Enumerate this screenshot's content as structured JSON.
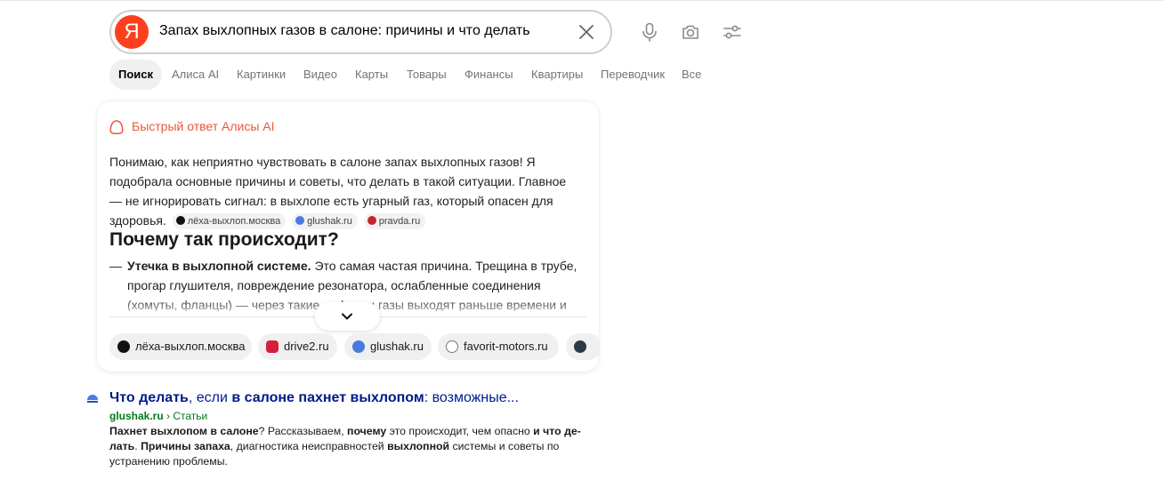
{
  "search": {
    "query": "Запах выхлопных газов в салоне: причины и что делать",
    "logo_letter": "Я"
  },
  "tabs": [
    {
      "label": "Поиск",
      "active": true
    },
    {
      "label": "Алиса AI"
    },
    {
      "label": "Картинки"
    },
    {
      "label": "Видео"
    },
    {
      "label": "Карты"
    },
    {
      "label": "Товары"
    },
    {
      "label": "Финансы"
    },
    {
      "label": "Квартиры"
    },
    {
      "label": "Переводчик"
    },
    {
      "label": "Все"
    }
  ],
  "answer": {
    "label": "Быстрый ответ Алисы AI",
    "intro": "Понимаю, как неприятно чувствовать в салоне запах выхлопных газов! Я подобрала основные причины и советы, что делать в такой ситуации. Главное — не игнорировать сигнал: в выхлопе есть угарный газ, который опасен для здоровья.",
    "inline_sources": [
      "лёха-выхлоп.москва",
      "glushak.ru",
      "pravda.ru"
    ],
    "heading": "Почему так происходит?",
    "bullet_dash": "—",
    "bullet_bold": "Утечка в выхлопной системе.",
    "bullet_text": " Это самая частая причина. Трещина в трубе, прогар глушителя, повреждение резонатора, ослабленные соединения (хомуты, фланцы) — через такие дефекты газы выходят раньше времени и",
    "source_chips": [
      "лёха-выхлоп.москва",
      "drive2.ru",
      "glushak.ru",
      "favorit-motors.ru"
    ]
  },
  "result": {
    "title_parts": [
      {
        "text": "Что делать",
        "bold": true
      },
      {
        "text": ", если ",
        "bold": false
      },
      {
        "text": "в салоне пахнет выхлопом",
        "bold": true
      },
      {
        "text": ": возможные...",
        "bold": false
      }
    ],
    "domain": "glushak.ru",
    "breadcrumb": " › Статьи",
    "snippet_parts": [
      {
        "text": "Пахнет выхлопом в салоне",
        "bold": true
      },
      {
        "text": "? Рассказываем, ",
        "bold": false
      },
      {
        "text": "почему",
        "bold": true
      },
      {
        "text": " это происходит, чем опасно ",
        "bold": false
      },
      {
        "text": "и что де-лать",
        "bold": true
      },
      {
        "text": ". ",
        "bold": false
      },
      {
        "text": "Причины запаха",
        "bold": true
      },
      {
        "text": ", диагностика неисправностей ",
        "bold": false
      },
      {
        "text": "выхлопной",
        "bold": true
      },
      {
        "text": " системы и советы по устранению проблемы.",
        "bold": false
      }
    ]
  },
  "colors": {
    "brand": "#fc3f1d",
    "alice_accent": "#e8593a",
    "link": "#001a8c",
    "url": "#007a1a"
  },
  "icons": [
    "close-icon",
    "microphone-icon",
    "camera-icon",
    "filters-icon",
    "alice-icon",
    "chevron-down-icon"
  ]
}
